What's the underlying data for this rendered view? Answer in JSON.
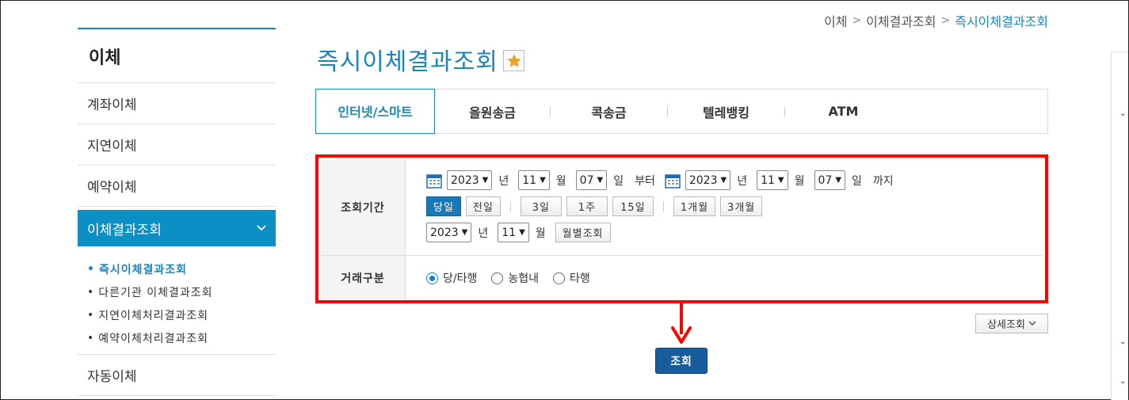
{
  "breadcrumb": {
    "items": [
      "이체",
      "이체결과조회"
    ],
    "current": "즉시이체결과조회",
    "sep": ">"
  },
  "sidebar": {
    "title": "이체",
    "items": [
      {
        "label": "계좌이체"
      },
      {
        "label": "지연이체"
      },
      {
        "label": "예약이체"
      }
    ],
    "active": {
      "label": "이체결과조회"
    },
    "sub_items": [
      {
        "label": "즉시이체결과조회"
      },
      {
        "label": "다른기관 이체결과조회"
      },
      {
        "label": "지연이체처리결과조회"
      },
      {
        "label": "예약이체처리결과조회"
      }
    ],
    "bottom_item": {
      "label": "자동이체"
    }
  },
  "main": {
    "title": "즉시이체결과조회",
    "tabs": [
      "인터넷/스마트",
      "올원송금",
      "콕송금",
      "텔레뱅킹",
      "ATM"
    ]
  },
  "form": {
    "period_label": "조회기간",
    "from": {
      "year": "2023",
      "month": "11",
      "day": "07"
    },
    "to": {
      "year": "2023",
      "month": "11",
      "day": "07"
    },
    "unit_year": "년",
    "unit_month": "월",
    "unit_day": "일",
    "from_suffix": "부터",
    "to_suffix": "까지",
    "quick_buttons": [
      "당일",
      "전일",
      "3일",
      "1주",
      "15일",
      "1개월",
      "3개월"
    ],
    "monthly": {
      "year": "2023",
      "month": "11",
      "button": "월별조회"
    },
    "type_label": "거래구분",
    "radios": [
      "당/타행",
      "농협내",
      "타행"
    ]
  },
  "detail_button": "상세조회",
  "search_button": "조회",
  "colors": {
    "accent": "#1a86b8",
    "highlight_box": "#ff0000",
    "active_menu": "#0b8fc4",
    "primary_button": "#175c9c"
  }
}
